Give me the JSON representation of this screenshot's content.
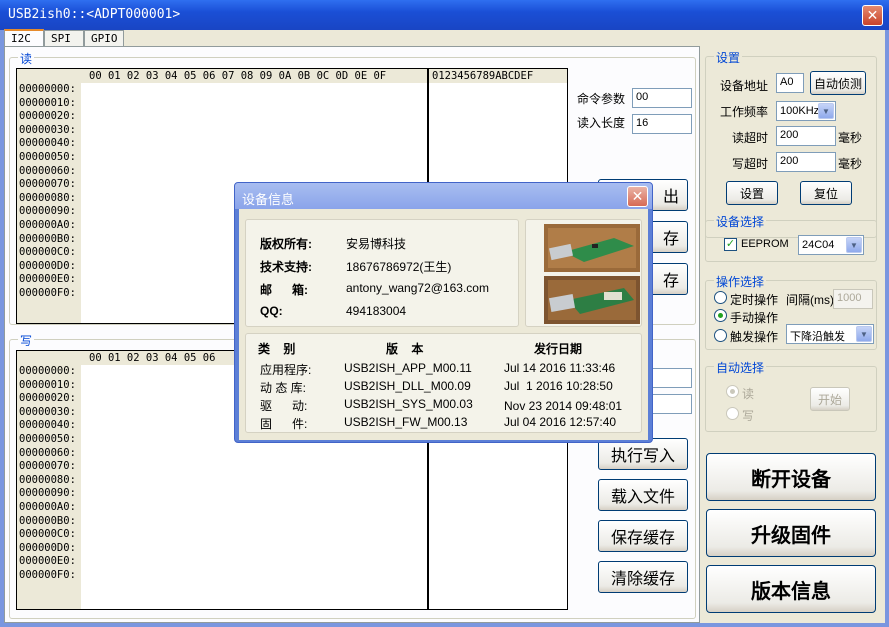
{
  "window": {
    "title": "USB2ish0::<ADPT000001>"
  },
  "tabs": [
    {
      "label": "I2C"
    },
    {
      "label": "SPI"
    },
    {
      "label": "GPIO"
    }
  ],
  "read_section": {
    "title": "读",
    "hex_header": "00 01 02 03 04 05 06 07 08 09 0A 0B 0C 0D 0E 0F",
    "ascii_header": "0123456789ABCDEF",
    "rows": [
      "00000000:",
      "00000010:",
      "00000020:",
      "00000030:",
      "00000040:",
      "00000050:",
      "00000060:",
      "00000070:",
      "00000080:",
      "00000090:",
      "000000A0:",
      "000000B0:",
      "000000C0:",
      "000000D0:",
      "000000E0:",
      "000000F0:"
    ],
    "cmd_param_label": "命令参数",
    "cmd_param_value": "00",
    "read_len_label": "读入长度",
    "read_len_value": "16",
    "btn_read_partial": "出",
    "btn_save_partial_1": "存",
    "btn_save_partial_2": "存"
  },
  "write_section": {
    "title": "写",
    "hex_header_visible": "00 01 02 03 04 05 06",
    "rows": [
      "00000000:",
      "00000010:",
      "00000020:",
      "00000030:",
      "00000040:",
      "00000050:",
      "00000060:",
      "00000070:",
      "00000080:",
      "00000090:",
      "000000A0:",
      "000000B0:",
      "000000C0:",
      "000000D0:",
      "000000E0:",
      "000000F0:"
    ],
    "btn_exec_write": "执行写入",
    "btn_load_file": "载入文件",
    "btn_save_buffer": "保存缓存",
    "btn_clear_buffer": "清除缓存"
  },
  "settings": {
    "title": "设置",
    "addr_label": "设备地址",
    "addr_value": "A0",
    "auto_detect": "自动侦测",
    "freq_label": "工作频率",
    "freq_value": "100KHz",
    "read_timeout_label": "读超时",
    "read_timeout_value": "200",
    "write_timeout_label": "写超时",
    "write_timeout_value": "200",
    "unit_ms": "毫秒",
    "btn_set": "设置",
    "btn_reset": "复位"
  },
  "device_select": {
    "title": "设备选择",
    "eeprom_label": "EEPROM",
    "chip_value": "24C04"
  },
  "operation_select": {
    "title": "操作选择",
    "timed_label": "定时操作",
    "interval_label": "间隔(ms)",
    "interval_value": "1000",
    "manual_label": "手动操作",
    "trigger_label": "触发操作",
    "trigger_value": "下降沿触发"
  },
  "auto_select": {
    "title": "自动选择",
    "read_label": "读",
    "write_label": "写",
    "btn_start": "开始"
  },
  "big_buttons": {
    "disconnect": "断开设备",
    "upgrade": "升级固件",
    "version": "版本信息"
  },
  "dialog": {
    "title": "设备信息",
    "copyright_label": "版权所有:",
    "copyright_value": "安易博科技",
    "support_label": "技术支持:",
    "support_value": "18676786972(王生)",
    "email_label": "邮      箱:",
    "email_value": "antony_wang72@163.com",
    "qq_label": "QQ:",
    "qq_value": "494183004",
    "col_type": "类    别",
    "col_version": "版    本",
    "col_date": "发行日期",
    "rows": [
      {
        "type": "应用程序:",
        "version": "USB2ISH_APP_M00.11",
        "date": "Jul 14 2016 11:33:46"
      },
      {
        "type": "动 态 库:",
        "version": "USB2ISH_DLL_M00.09",
        "date": "Jul  1 2016 10:28:50"
      },
      {
        "type": "驱      动:",
        "version": "USB2ISH_SYS_M00.03",
        "date": "Nov 23 2014 09:48:01"
      },
      {
        "type": "固      件:",
        "version": "USB2ISH_FW_M00.13",
        "date": "Jul 04 2016 12:57:40"
      }
    ]
  },
  "colors": {
    "title_blue": "#1a4fd6",
    "group_title": "#0046d5",
    "face": "#ece9d8"
  }
}
